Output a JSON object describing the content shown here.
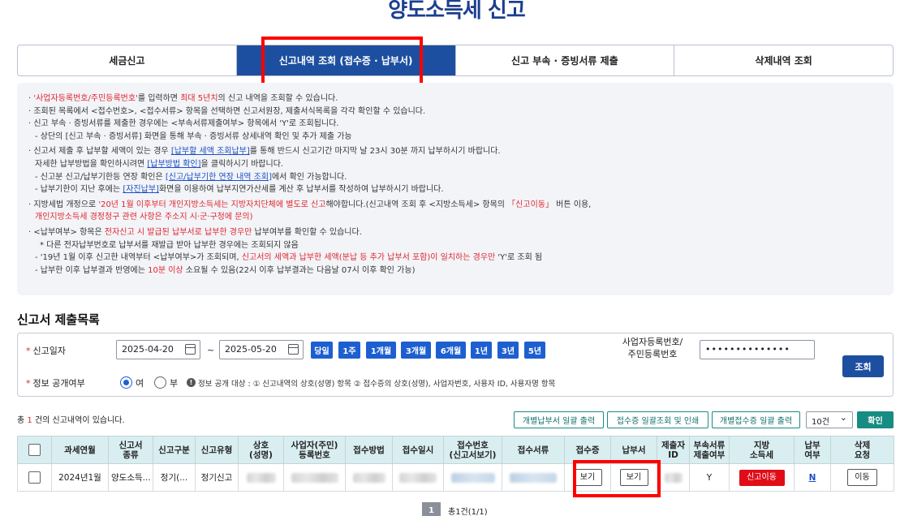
{
  "page": {
    "title": "양도소득세 신고"
  },
  "tabs": [
    {
      "label": "세금신고"
    },
    {
      "label": "신고내역 조회 (접수증 · 납부서)"
    },
    {
      "label": "신고 부속 · 증빙서류 제출"
    },
    {
      "label": "삭제내역 조회"
    }
  ],
  "notice": {
    "l1a": "'사업자등록번호/주민등록번호'",
    "l1b": "를 입력하면 ",
    "l1c": "최대 5년치",
    "l1d": "의 신고 내역을 조회할 수 있습니다.",
    "l2": "조회된 목록에서 <접수번호>, <접수서류> 항목을 선택하면 신고서원장, 제출서식목록을 각각 확인할 수 있습니다.",
    "l3": "신고 부속 · 증빙서류를 제출한 경우에는 <부속서류제출여부> 항목에서 'Y'로 조회됩니다.",
    "l4": "- 상단의 [신고 부속 · 증빙서류] 화면을 통해 부속 · 증빙서류 상세내역 확인 및 추가 제출 가능",
    "l5a": "신고서 제출 후 납부할 세액이 있는 경우 ",
    "l5b": "[납부할 세액 조회납부]",
    "l5c": "를 통해 반드시 신고기간 마지막 날 23시 30분 까지 납부하시기 바랍니다.",
    "l6a": "자세한 납부방법을 확인하시려면 ",
    "l6b": "[납부방법 확인]",
    "l6c": "을 클릭하시기 바랍니다.",
    "l7a": "- 신고분 신고/납부기한등 연장 확인은 ",
    "l7b": "[신고/납부기한 연장 내역 조회]",
    "l7c": "에서 확인 가능합니다.",
    "l8a": "- 납부기한이 지난 후에는 ",
    "l8b": "[자진납부]",
    "l8c": "화면을 이용하여 납부지연가산세를 계산 후 납부서를 작성하여 납부하시기 바랍니다.",
    "l9a": "지방세법 개정으로 ",
    "l9b": "'20년 1월 이후부터 개인지방소득세는 지방자치단체에 별도로 신고",
    "l9c": "해야합니다.(신고내역 조회 후 <지방소득세> 항목의 ",
    "l9d": "「신고이동」",
    "l9e": " 버튼 이용,",
    "l10": "개인지방소득세 경정청구 관련 사항은 주소지 시·군·구청에 문의)",
    "l11a": "<납부여부> 항목은 ",
    "l11b": "전자신고 시 발급된 납부서로 납부한 경우만",
    "l11c": " 납부여부를 확인할 수 있습니다.",
    "l12": "* 다른 전자납부번호로 납부서를 재발급 받아 납부한 경우에는 조회되지 않음",
    "l13a": "- '19년 1월 이후 신고한 내역부터 <납부여부>가 조회되며, ",
    "l13b": "신고서의 세액과 납부한 세액(분납 등 추가 납부서 포함)이 일치하는 경우만",
    "l13c": " 'Y'로 조회 됨",
    "l14a": "- 납부한 이후 납부결과 반영에는 ",
    "l14b": "10분 이상",
    "l14c": " 소요될 수 있음(22시 이후 납부결과는 다음날 07시 이후 확인 가능)"
  },
  "section": {
    "title": "신고서 제출목록"
  },
  "search": {
    "date_label": "신고일자",
    "date_from": "2025-04-20",
    "tilde": "~",
    "date_to": "2025-05-20",
    "quick": [
      "당일",
      "1주",
      "1개월",
      "3개월",
      "6개월",
      "1년",
      "3년",
      "5년"
    ],
    "id_label_1": "사업자등록번호/",
    "id_label_2": "주민등록번호",
    "id_value": "••••••••••••••",
    "public_label": "정보 공개여부",
    "yes": "여",
    "no": "부",
    "public_info": "정보 공개 대상 : ① 신고내역의 상호(성명) 항목 ② 접수증의 상호(성명), 사업자번호, 사용자 ID, 사용자명 항목",
    "search_btn": "조회"
  },
  "actions": {
    "count_prefix": "총 ",
    "count_value": "1",
    "count_suffix": " 건의 신고내역이 있습니다.",
    "btn1": "개별납부서 일괄 출력",
    "btn2": "접수증 일괄조회 및 인쇄",
    "btn3": "개별접수증 일괄 출력",
    "page_size": "10건",
    "ok": "확인"
  },
  "table": {
    "headers": [
      [
        "",
        ""
      ],
      [
        "과세연월",
        ""
      ],
      [
        "신고서",
        "종류"
      ],
      [
        "신고구분",
        ""
      ],
      [
        "신고유형",
        ""
      ],
      [
        "상호",
        "(성명)"
      ],
      [
        "사업자(주민)",
        "등록번호"
      ],
      [
        "접수방법",
        ""
      ],
      [
        "접수일시",
        ""
      ],
      [
        "접수번호",
        "(신고서보기)"
      ],
      [
        "접수서류",
        ""
      ],
      [
        "접수증",
        ""
      ],
      [
        "납부서",
        ""
      ],
      [
        "제출자",
        "ID"
      ],
      [
        "부속서류",
        "제출여부"
      ],
      [
        "지방",
        "소득세"
      ],
      [
        "납부",
        "여부"
      ],
      [
        "삭제",
        "요청"
      ]
    ],
    "row": {
      "period": "2024년1월",
      "kind": "양도소득...",
      "category": "정기(...",
      "type": "정기신고",
      "receipt_btn": "보기",
      "payslip_btn": "보기",
      "attach": "Y",
      "local_tax_btn": "신고이동",
      "paid": "N",
      "delete_btn": "이동"
    }
  },
  "pager": {
    "current": "1",
    "total": "총1건(1/1)"
  }
}
